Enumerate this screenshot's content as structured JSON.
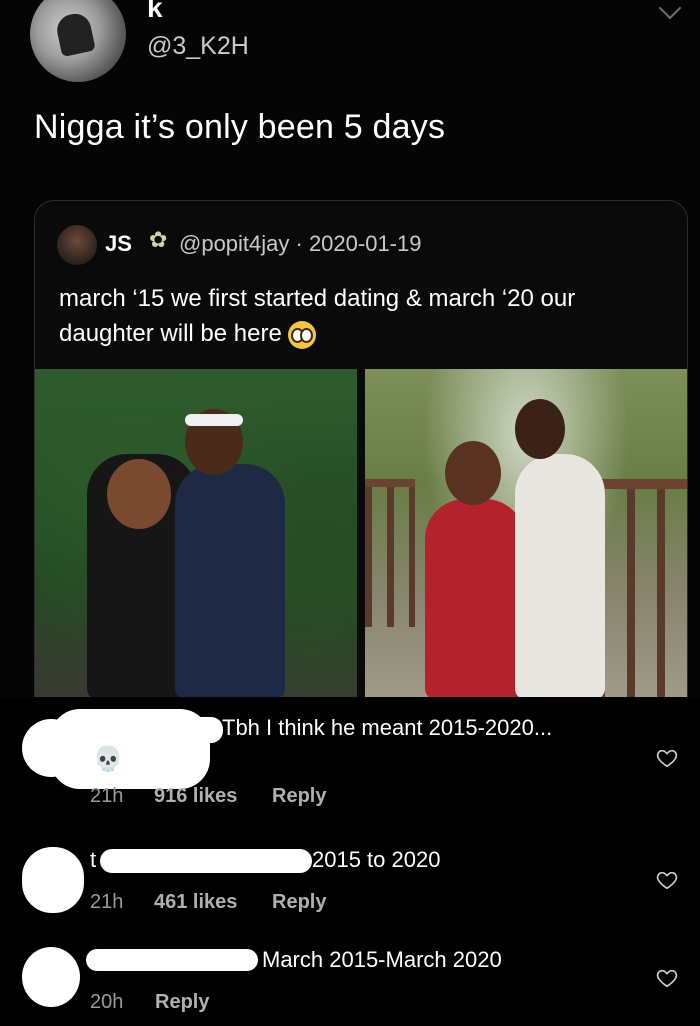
{
  "tweet": {
    "display_name": "k",
    "handle": "@3_K2H",
    "text": "Nigga it’s only been 5 days"
  },
  "quoted": {
    "name": "JS",
    "fairy_icon": "fairy-emoji",
    "meta": "@popit4jay · 2020-01-19",
    "text": "march ‘15 we first started dating & march ‘20 our daughter will be here",
    "emoji": "pleading-face-emoji"
  },
  "comments": [
    {
      "text": "Tbh I think he meant 2015-2020...",
      "emoji": "skull-emoji",
      "time": "21h",
      "likes": "916 likes",
      "reply": "Reply"
    },
    {
      "prefix": "t",
      "text": "2015 to 2020",
      "time": "21h",
      "likes": "461 likes",
      "reply": "Reply"
    },
    {
      "text": "March 2015-March 2020",
      "time": "20h",
      "reply": "Reply"
    }
  ]
}
